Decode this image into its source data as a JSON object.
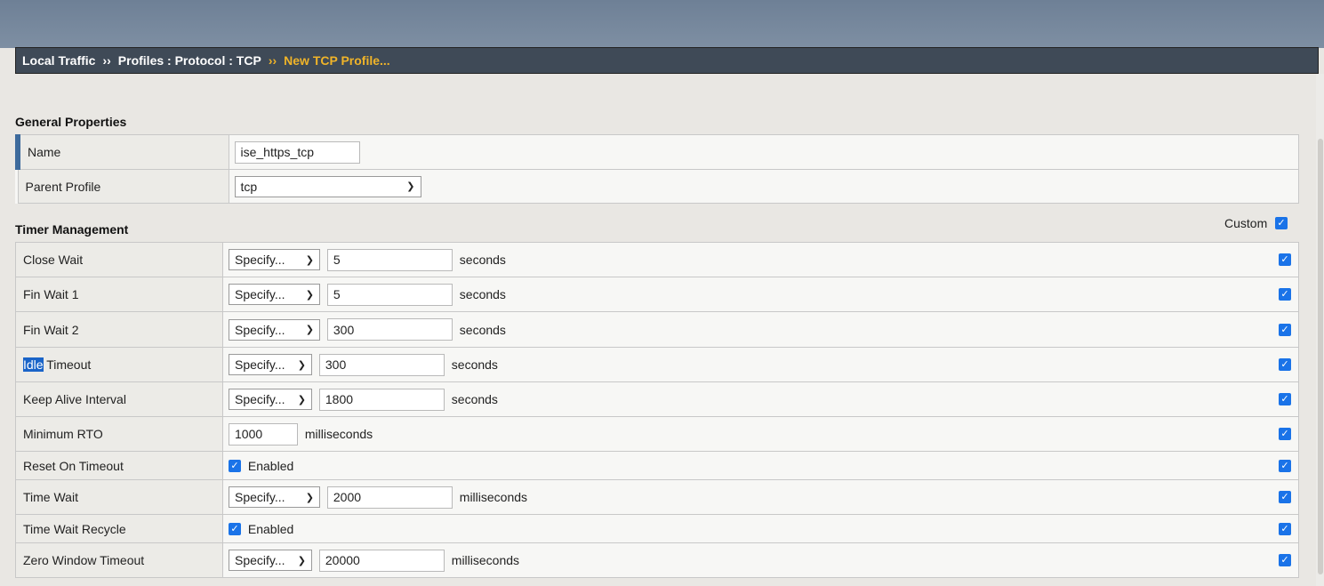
{
  "breadcrumb": {
    "part1": "Local Traffic",
    "sep": "››",
    "part2": "Profiles : Protocol : TCP",
    "current": "New TCP Profile..."
  },
  "general": {
    "title": "General Properties",
    "name_label": "Name",
    "name_value": "ise_https_tcp",
    "parent_label": "Parent Profile",
    "parent_value": "tcp"
  },
  "timer": {
    "title": "Timer Management",
    "custom_label": "Custom",
    "rows": [
      {
        "label": "Close Wait",
        "mode": "Specify...",
        "value": "5",
        "unit": "seconds"
      },
      {
        "label": "Fin Wait 1",
        "mode": "Specify...",
        "value": "5",
        "unit": "seconds"
      },
      {
        "label": "Fin Wait 2",
        "mode": "Specify...",
        "value": "300",
        "unit": "seconds"
      },
      {
        "label_hl": "Idle",
        "label_rest": " Timeout",
        "mode": "Specify...",
        "value": "300",
        "unit": "seconds"
      },
      {
        "label": "Keep Alive Interval",
        "mode": "Specify...",
        "value": "1800",
        "unit": "seconds"
      },
      {
        "label": "Minimum RTO",
        "value": "1000",
        "unit": "milliseconds"
      },
      {
        "label": "Reset On Timeout",
        "checkbox_label": "Enabled"
      },
      {
        "label": "Time Wait",
        "mode": "Specify...",
        "value": "2000",
        "unit": "milliseconds"
      },
      {
        "label": "Time Wait Recycle",
        "checkbox_label": "Enabled"
      },
      {
        "label": "Zero Window Timeout",
        "mode": "Specify...",
        "value": "20000",
        "unit": "milliseconds"
      }
    ]
  },
  "icons": {
    "check": "checkmark-icon",
    "chevron": "chevron-down-icon"
  },
  "colors": {
    "accent": "#3d6a9c",
    "checkbox": "#1a73e8",
    "current_crumb": "#f0b429"
  }
}
